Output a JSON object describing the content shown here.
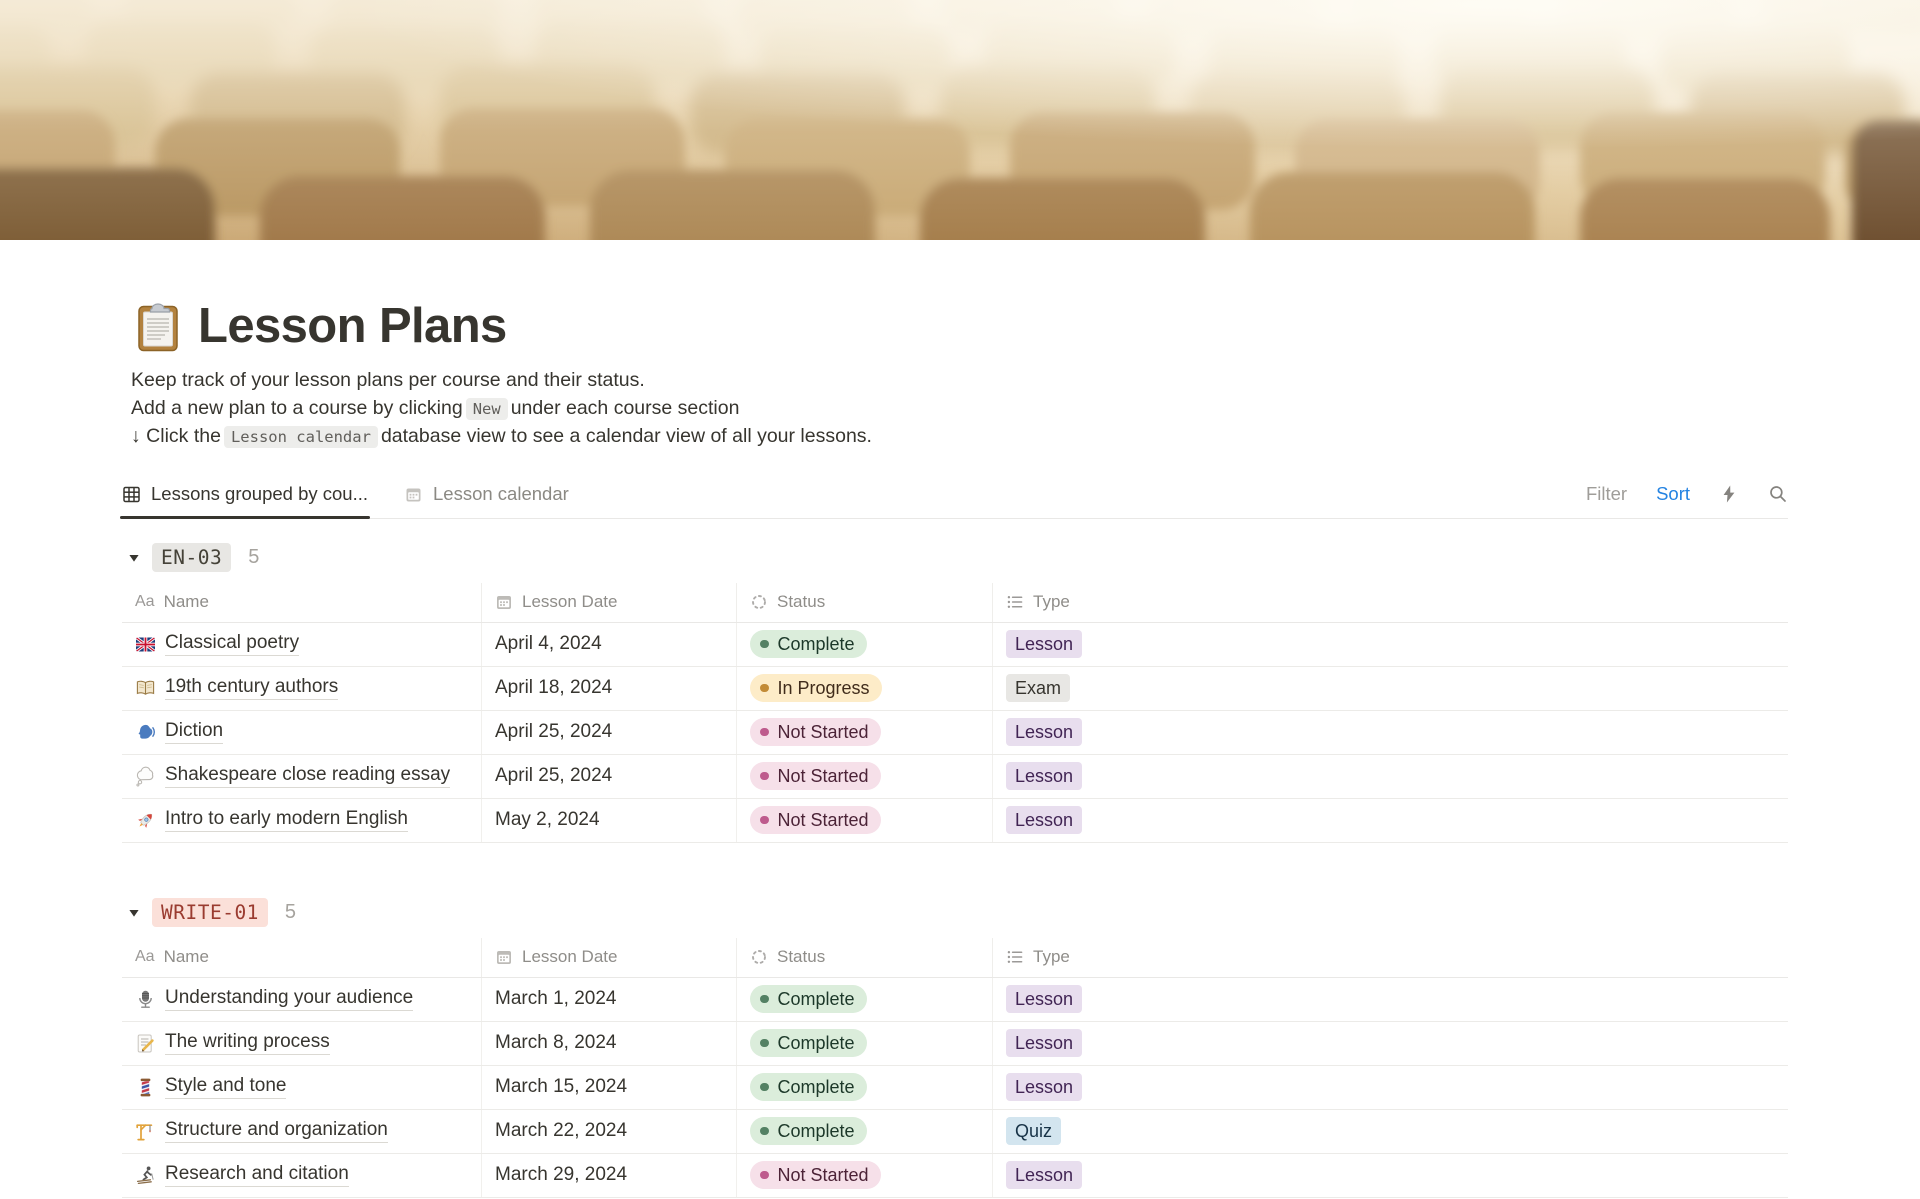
{
  "page": {
    "icon": "clipboard-icon",
    "title": "Lesson Plans",
    "description_lines": [
      {
        "parts": [
          {
            "t": "text",
            "v": "Keep track of your lesson plans per course and their status."
          }
        ]
      },
      {
        "parts": [
          {
            "t": "text",
            "v": "Add a new plan to a course by clicking"
          },
          {
            "t": "code",
            "v": "New"
          },
          {
            "t": "text",
            "v": "under each course section"
          }
        ]
      },
      {
        "parts": [
          {
            "t": "text",
            "v": "↓ Click the"
          },
          {
            "t": "code",
            "v": "Lesson calendar"
          },
          {
            "t": "text",
            "v": "database view to see a calendar view of all your lessons."
          }
        ]
      }
    ]
  },
  "toolbar": {
    "tabs": [
      {
        "label": "Lessons grouped by cou...",
        "icon": "table-view-icon",
        "active": true
      },
      {
        "label": "Lesson calendar",
        "icon": "calendar-view-icon",
        "active": false
      }
    ],
    "filter_label": "Filter",
    "sort_label": "Sort",
    "sort_color": "#2483E2"
  },
  "table": {
    "columns": [
      {
        "label": "Name",
        "icon": "text-icon"
      },
      {
        "label": "Lesson Date",
        "icon": "calendar-icon"
      },
      {
        "label": "Status",
        "icon": "status-spinner-icon"
      },
      {
        "label": "Type",
        "icon": "bulleted-list-icon"
      }
    ]
  },
  "groups": [
    {
      "name": "EN-03",
      "count": "5",
      "badge_bg": "#E8E7E4",
      "badge_color": "#454238",
      "rows": [
        {
          "icon": "uk-flag",
          "name": "Classical poetry",
          "date": "April 4, 2024",
          "status": "Complete",
          "type": "Lesson"
        },
        {
          "icon": "open-book",
          "name": "19th century authors",
          "date": "April 18, 2024",
          "status": "In Progress",
          "type": "Exam"
        },
        {
          "icon": "speaking-head",
          "name": "Diction",
          "date": "April 25, 2024",
          "status": "Not Started",
          "type": "Lesson"
        },
        {
          "icon": "thought-balloon",
          "name": "Shakespeare close reading essay",
          "date": "April 25, 2024",
          "status": "Not Started",
          "type": "Lesson"
        },
        {
          "icon": "rocket",
          "name": "Intro to early modern English",
          "date": "May 2, 2024",
          "status": "Not Started",
          "type": "Lesson"
        }
      ]
    },
    {
      "name": "WRITE-01",
      "count": "5",
      "badge_bg": "#FBE0D9",
      "badge_color": "#9A3B30",
      "rows": [
        {
          "icon": "microphone",
          "name": "Understanding your audience",
          "date": "March 1, 2024",
          "status": "Complete",
          "type": "Lesson"
        },
        {
          "icon": "memo",
          "name": "The writing process",
          "date": "March 8, 2024",
          "status": "Complete",
          "type": "Lesson"
        },
        {
          "icon": "thread-spool",
          "name": "Style and tone",
          "date": "March 15, 2024",
          "status": "Complete",
          "type": "Lesson"
        },
        {
          "icon": "building-crane",
          "name": "Structure and organization",
          "date": "March 22, 2024",
          "status": "Complete",
          "type": "Quiz"
        },
        {
          "icon": "skier",
          "name": "Research and citation",
          "date": "March 29, 2024",
          "status": "Not Started",
          "type": "Lesson"
        }
      ]
    }
  ],
  "status_styles": {
    "Complete": {
      "bg": "#DBEDDB",
      "dot": "#548164",
      "text": "#1C3829"
    },
    "In Progress": {
      "bg": "#FDECC8",
      "dot": "#C28B37",
      "text": "#402C1B"
    },
    "Not Started": {
      "bg": "#F6E0E9",
      "dot": "#BE5B8D",
      "text": "#4C2337"
    }
  },
  "type_styles": {
    "Lesson": {
      "bg": "#E8DEEE",
      "text": "#412454"
    },
    "Exam": {
      "bg": "#E8E7E4",
      "text": "#37352F"
    },
    "Quiz": {
      "bg": "#D3E5EF",
      "text": "#183347"
    }
  }
}
